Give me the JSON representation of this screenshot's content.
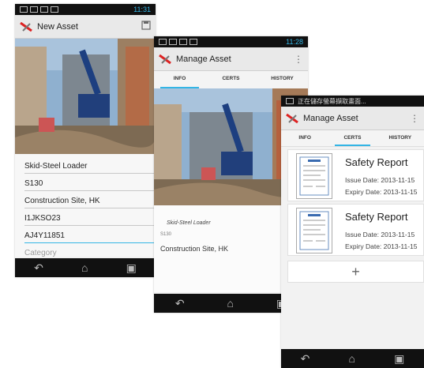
{
  "screen1": {
    "status_time": "11:31",
    "title": "New Asset",
    "save_icon": "save-icon",
    "fields": [
      {
        "value": "Skid-Steel Loader"
      },
      {
        "value": "S130"
      },
      {
        "value": "Construction Site, HK"
      },
      {
        "value": "I1JKSO23"
      },
      {
        "value": "AJ4Y11851"
      }
    ],
    "category_placeholder": "Category"
  },
  "screen2": {
    "status_time": "11:28",
    "title": "Manage Asset",
    "menu_icon": "overflow-menu-icon",
    "tabs": [
      "INFO",
      "CERTS",
      "HISTORY"
    ],
    "active_tab": "INFO",
    "asset_name": "Skid-Steel Loader",
    "asset_model": "S130",
    "location": "Construction Site, HK"
  },
  "screen3": {
    "status_text": "正在儲存螢幕擷取畫面...",
    "title": "Manage Asset",
    "tabs": [
      "INFO",
      "CERTS",
      "HISTORY"
    ],
    "active_tab": "CERTS",
    "certs": [
      {
        "title": "Safety Report",
        "issue": "Issue Date: 2013-11-15",
        "expiry": "Expiry Date: 2013-11-15"
      },
      {
        "title": "Safety Report",
        "issue": "Issue Date: 2013-11-15",
        "expiry": "Expiry Date: 2013-11-15"
      }
    ],
    "add_label": "+"
  },
  "colors": {
    "accent": "#33b5e5",
    "statusbar": "#111111",
    "actionbar": "#e9e9e9"
  }
}
